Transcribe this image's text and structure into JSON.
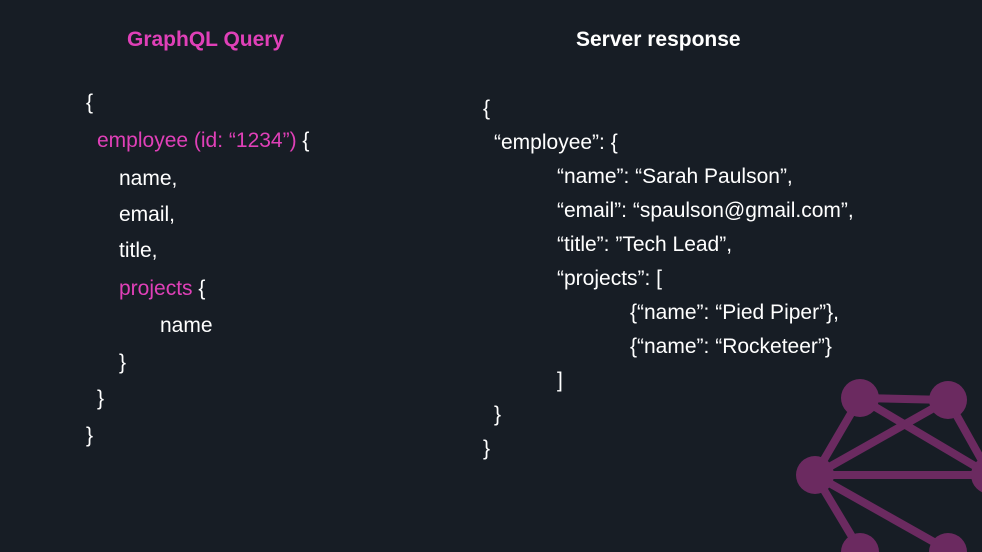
{
  "query": {
    "heading": "GraphQL Query",
    "lines": [
      {
        "text": "{"
      },
      {
        "pink": "employee (id: “1234”)",
        "text": " {"
      },
      {
        "text": "name,"
      },
      {
        "text": "email,"
      },
      {
        "text": "title,"
      },
      {
        "pink": "projects",
        "text": " {"
      },
      {
        "text": "name"
      },
      {
        "text": "}"
      },
      {
        "text": "}"
      },
      {
        "text": "}"
      }
    ]
  },
  "response": {
    "heading": "Server response",
    "lines": [
      "{",
      "“employee”: {",
      "“name”: “Sarah Paulson”,",
      "“email”: “spaulson@gmail.com”,",
      "“title”: ”Tech Lead”,",
      "“projects”: [",
      "{“name”: “Pied Piper”},",
      "{“name”: “Rocketeer”}",
      "]",
      "}",
      "}"
    ]
  },
  "colors": {
    "background": "#171d25",
    "accent": "#e040b8",
    "logo": "#6b2a60"
  },
  "logo": {
    "icon": "graphql-logo-icon"
  }
}
